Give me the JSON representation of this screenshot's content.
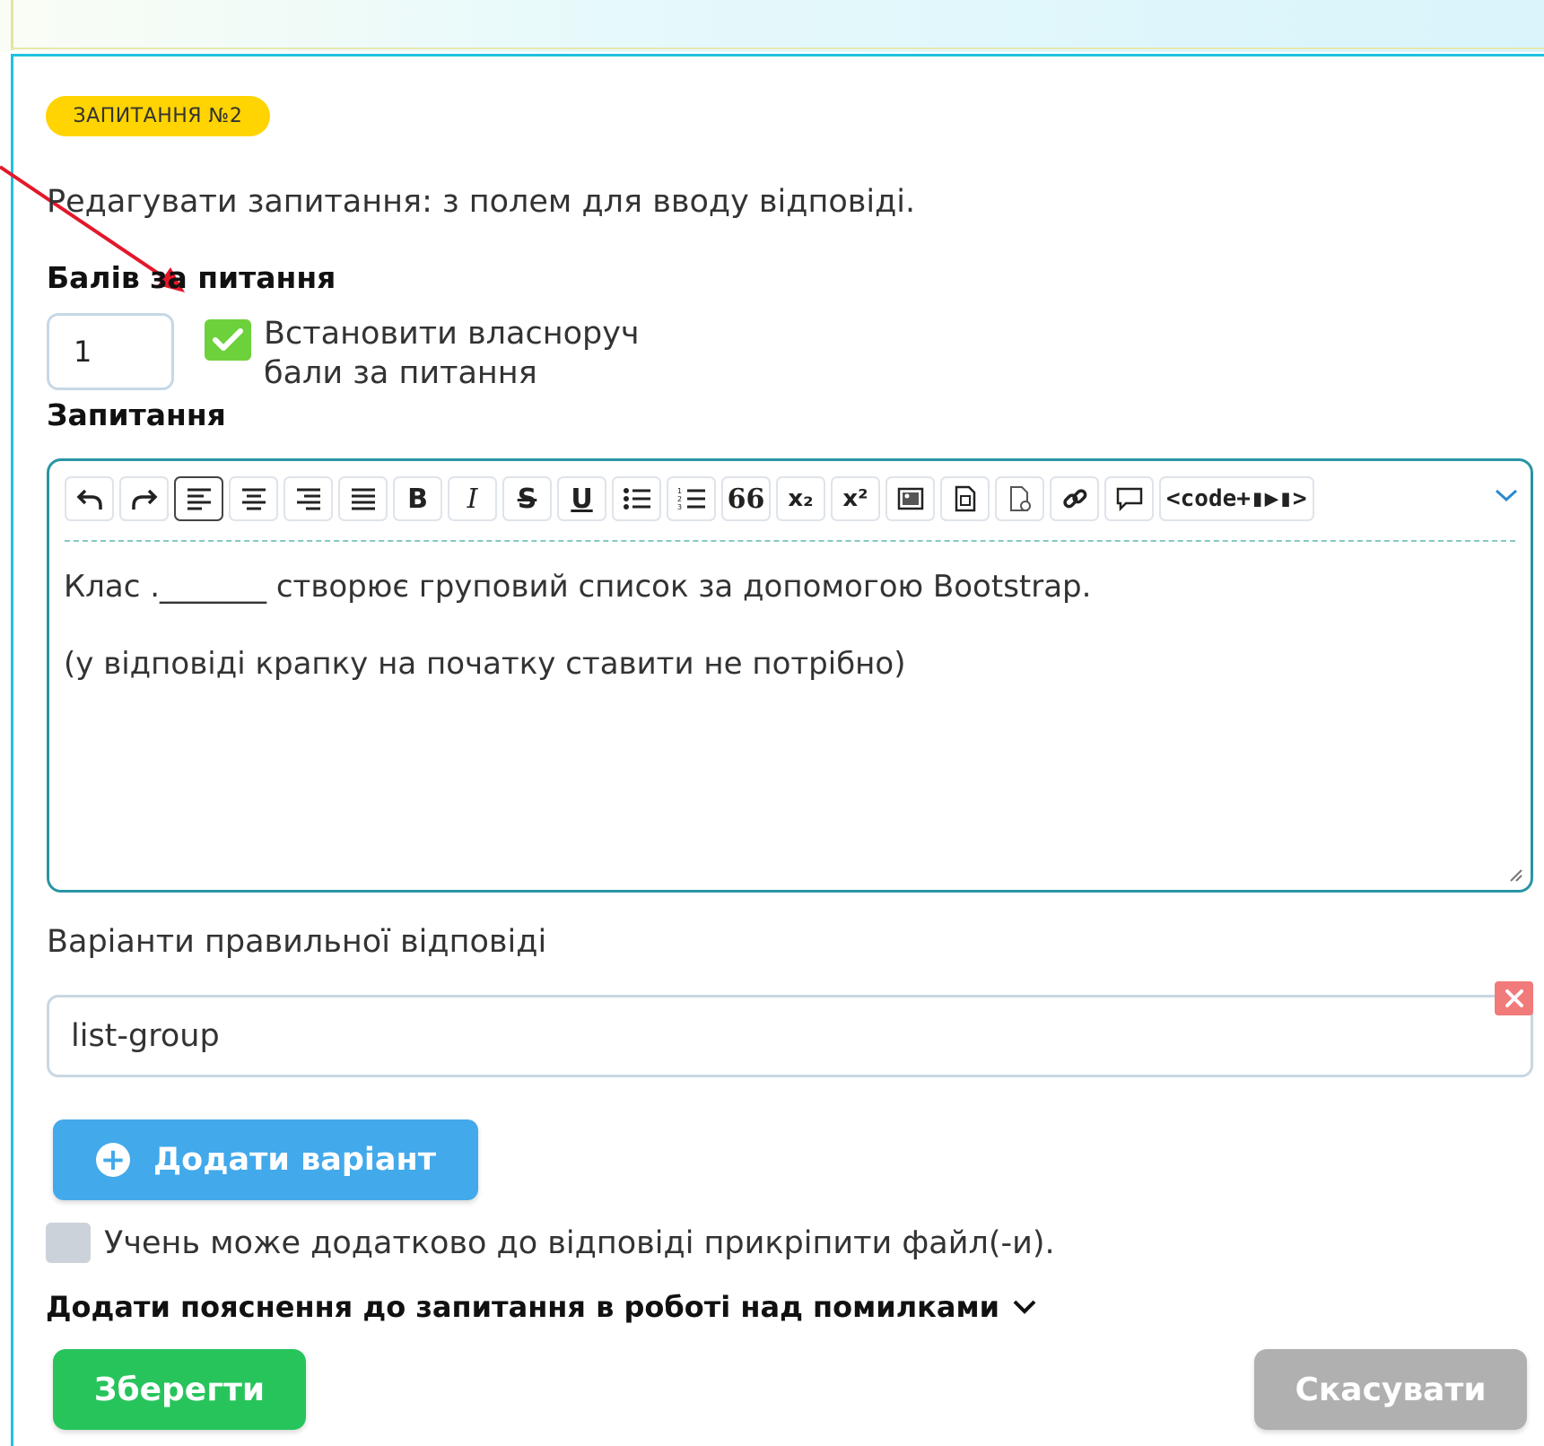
{
  "badge": "ЗАПИТАННЯ №2",
  "subtitle": "Редагувати запитання: з полем для вводу відповіді.",
  "points": {
    "label": "Балів за питання",
    "value": "1",
    "manual_line1": "Встановити власноруч",
    "manual_line2": "бали за питання",
    "manual_checked": true
  },
  "question": {
    "label": "Запитання",
    "toolbar": [
      "undo-icon",
      "redo-icon",
      "align-left-icon",
      "align-center-icon",
      "align-right-icon",
      "align-justify-icon",
      "bold-icon",
      "italic-icon",
      "strikethrough-icon",
      "underline-icon",
      "bulleted-list-icon",
      "numbered-list-icon",
      "blockquote-icon",
      "subscript-icon",
      "superscript-icon",
      "image-icon",
      "file-icon",
      "media-icon",
      "link-icon",
      "comment-icon"
    ],
    "toolbar_labels": {
      "bold": "B",
      "italic": "I",
      "strike": "S",
      "underline": "U",
      "quote": "66",
      "subscript": "x₂",
      "superscript": "x²",
      "code": "<code+▮▶▮>"
    },
    "line1": "Клас ._______ створює груповий список за допомогою Bootstrap.",
    "line2": "(у відповіді крапку на початку ставити не потрібно)"
  },
  "answers": {
    "label": "Варіанти правильної відповіді",
    "items": [
      "list-group"
    ],
    "add_label": "Додати варіант"
  },
  "attach": {
    "label": "Учень може додатково до відповіді прикріпити файл(-и).",
    "checked": false
  },
  "explain_label": "Додати пояснення до запитання в роботі над помилками",
  "buttons": {
    "save": "Зберегти",
    "cancel": "Скасувати"
  },
  "colors": {
    "accent": "#1fc2e0",
    "badge": "#ffd400",
    "check": "#6dd13b",
    "add": "#42a9eb",
    "save": "#27c45c",
    "cancel": "#b0b0b0",
    "remove": "#f17a7a"
  }
}
